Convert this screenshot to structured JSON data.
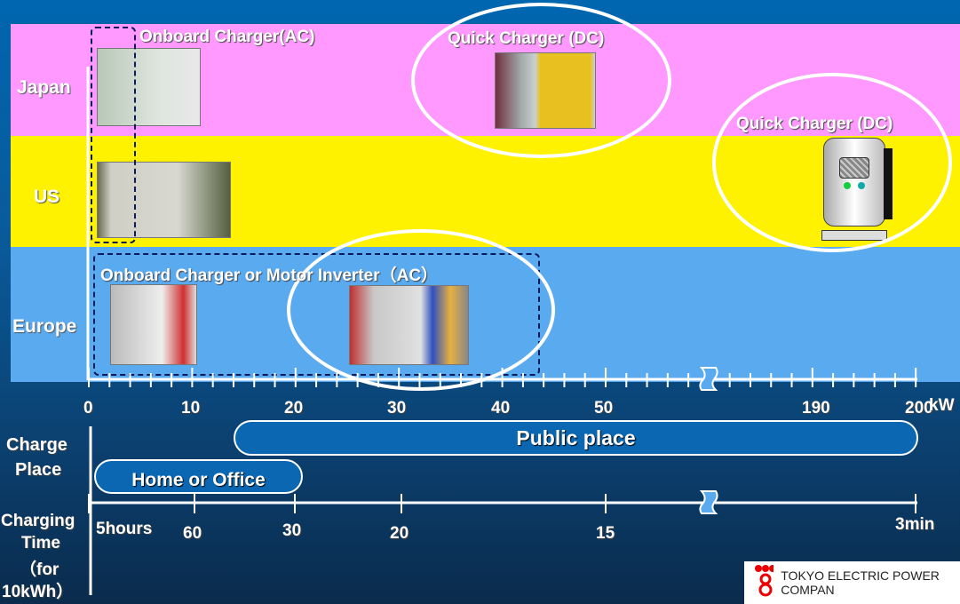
{
  "rows": [
    {
      "label": "Japan",
      "color": "#ff99ff"
    },
    {
      "label": "US",
      "color": "#fff200"
    },
    {
      "label": "Europe",
      "color": "#5aaaf0"
    }
  ],
  "annotations": {
    "onboard_ac": "Onboard Charger(AC)",
    "quick_dc_japan": "Quick Charger (DC)",
    "quick_dc_us": "Quick Charger (DC)",
    "onboard_motor": "Onboard Charger or Motor Inverter（AC）"
  },
  "power_axis": {
    "ticks": [
      "0",
      "10",
      "20",
      "30",
      "40",
      "50",
      "190",
      "200"
    ],
    "unit": "kW",
    "break_between": [
      "50",
      "190"
    ]
  },
  "charge_place": {
    "label_line1": "Charge",
    "label_line2": "Place",
    "public": "Public place",
    "home": "Home or Office",
    "public_range_kw": [
      14,
      200
    ],
    "home_range_kw": [
      0,
      20
    ]
  },
  "charging_time": {
    "label_line1": "Charging",
    "label_line2": "Time",
    "label_line3": "（for",
    "label_line4": "10kWh）",
    "ticks": [
      "5hours",
      "60",
      "30",
      "20",
      "15",
      "3min"
    ]
  },
  "logo": {
    "text": "TOKYO ELECTRIC POWER COMPAN",
    "mark": "TEPCO"
  },
  "icons": [
    "car-charging-photo",
    "charging-outlet-photo",
    "quick-charger-photo",
    "charger-station-illustration"
  ]
}
